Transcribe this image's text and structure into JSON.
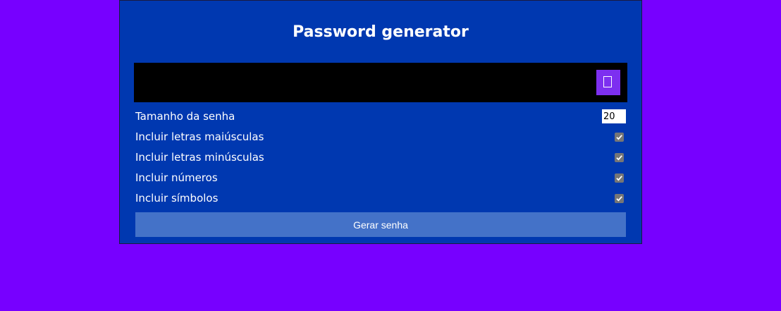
{
  "page": {
    "background_color": "#7700ff"
  },
  "card": {
    "title": "Password generator",
    "background_color": "#0038b0"
  },
  "result": {
    "value": "",
    "copy_icon": "copy-icon",
    "copy_button_color": "#7d2ff0"
  },
  "settings": {
    "length": {
      "label": "Tamanho da senha",
      "value": "20"
    },
    "uppercase": {
      "label": "Incluir letras maiúsculas",
      "checked": true
    },
    "lowercase": {
      "label": "Incluir letras minúsculas",
      "checked": true
    },
    "numbers": {
      "label": "Incluir números",
      "checked": true
    },
    "symbols": {
      "label": "Incluir símbolos",
      "checked": true
    }
  },
  "generate_button": {
    "label": "Gerar senha",
    "color": "#4472c8"
  }
}
